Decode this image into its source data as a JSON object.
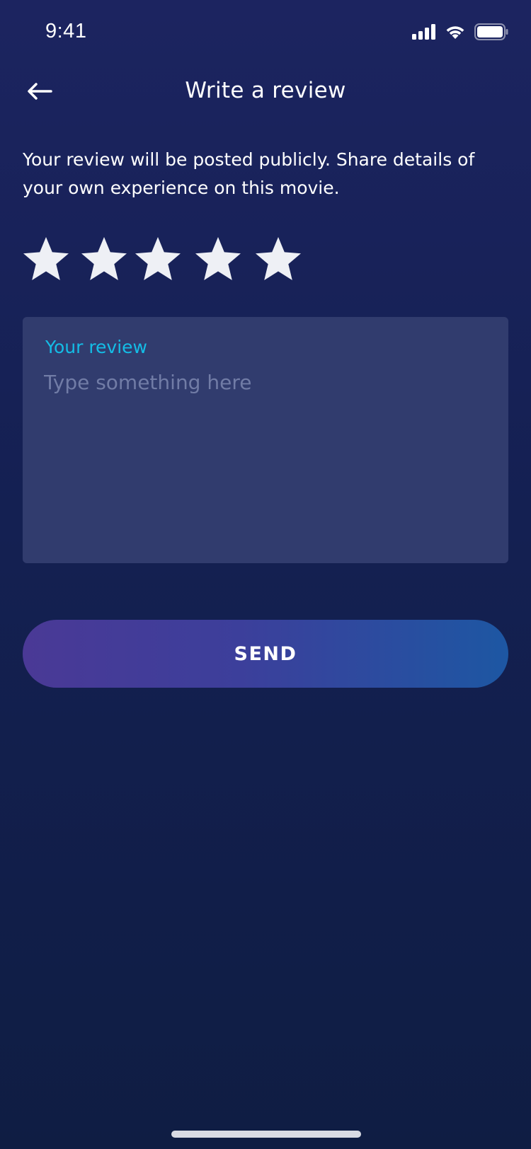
{
  "status_bar": {
    "time": "9:41",
    "icons": [
      "cellular-signal-icon",
      "wifi-icon",
      "battery-icon"
    ]
  },
  "header": {
    "back_icon": "arrow-left-icon",
    "title": "Write a review"
  },
  "description": "Your review will be posted publicly. Share details of your own experience on this movie.",
  "rating": {
    "max": 5,
    "selected": 0
  },
  "review": {
    "label": "Your review",
    "placeholder": "Type something here",
    "value": ""
  },
  "send_button": {
    "label": "SEND"
  },
  "colors": {
    "background_top": "#1c2460",
    "background_bottom": "#0f1d43",
    "card": "#313c6e",
    "accent_label": "#14bde6",
    "placeholder": "#717ca6",
    "star": "#eef0f5",
    "button_gradient_start": "#4a3996",
    "button_gradient_end": "#1d57a3"
  }
}
